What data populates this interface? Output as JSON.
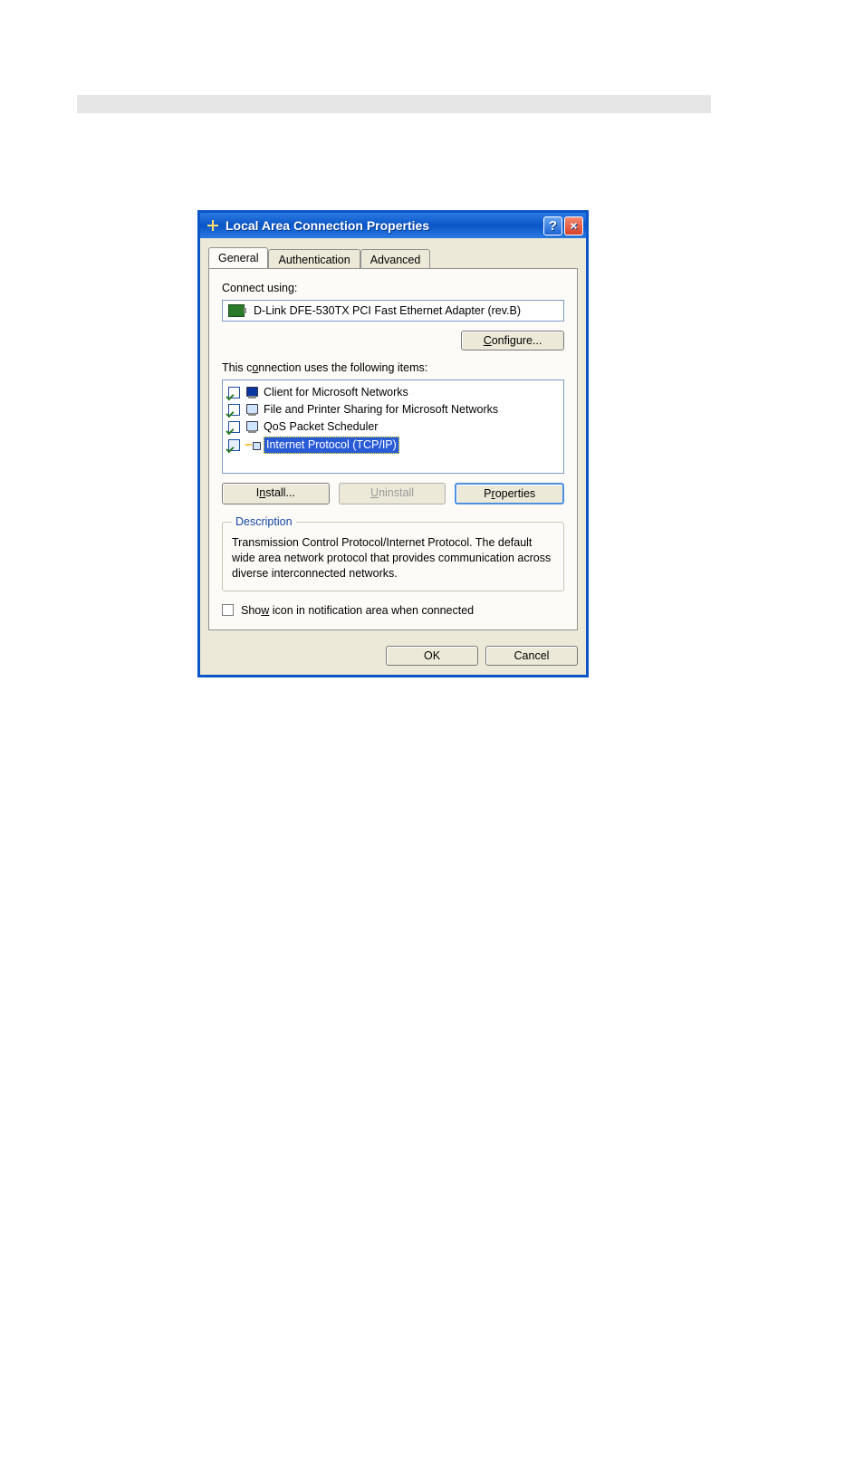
{
  "window": {
    "title": "Local Area Connection Properties"
  },
  "tabs": {
    "general": "General",
    "authentication": "Authentication",
    "advanced": "Advanced"
  },
  "connect_using_label": "Connect using:",
  "adapter_name": "D-Link DFE-530TX PCI Fast Ethernet Adapter (rev.B)",
  "configure_btn": "Configure...",
  "items_label": "This connection uses the following items:",
  "items": [
    {
      "checked": true,
      "label": "Client for Microsoft Networks"
    },
    {
      "checked": true,
      "label": "File and Printer Sharing for Microsoft Networks"
    },
    {
      "checked": true,
      "label": "QoS Packet Scheduler"
    },
    {
      "checked": true,
      "label": "Internet Protocol (TCP/IP)",
      "selected": true
    }
  ],
  "buttons": {
    "install": "Install...",
    "uninstall": "Uninstall",
    "properties": "Properties",
    "ok": "OK",
    "cancel": "Cancel"
  },
  "description": {
    "legend": "Description",
    "text": "Transmission Control Protocol/Internet Protocol. The default wide area network protocol that provides communication across diverse interconnected networks."
  },
  "show_icon_label": "Show icon in notification area when connected"
}
